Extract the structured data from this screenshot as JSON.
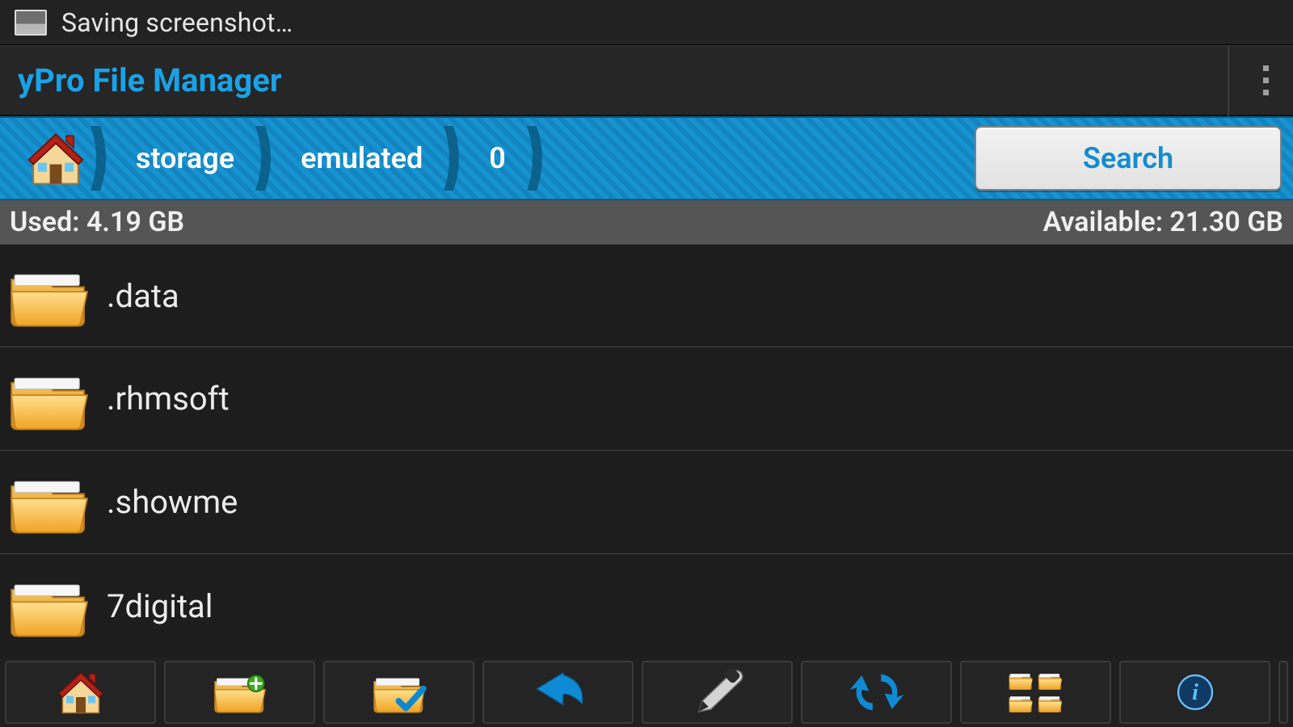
{
  "status_bar": {
    "notification_text": "Saving screenshot…"
  },
  "app": {
    "title": "yPro File Manager"
  },
  "breadcrumb": {
    "items": [
      "storage",
      "emulated",
      "0"
    ],
    "search_label": "Search"
  },
  "storage": {
    "used_label": "Used: 4.19 GB",
    "available_label": "Available: 21.30 GB"
  },
  "files": [
    {
      "name": ".data"
    },
    {
      "name": ".rhmsoft"
    },
    {
      "name": ".showme"
    },
    {
      "name": "7digital"
    }
  ],
  "toolbar": {
    "home": "Home",
    "newfolder": "New Folder",
    "select": "Select",
    "back": "Back",
    "edit": "Edit",
    "refresh": "Refresh",
    "view": "Multi-view",
    "info": "Info"
  }
}
